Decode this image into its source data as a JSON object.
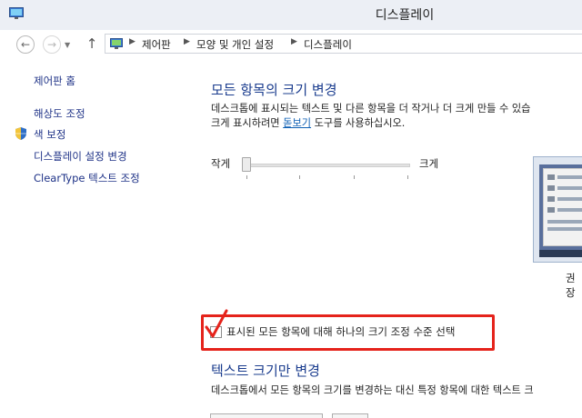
{
  "window": {
    "title": "디스플레이"
  },
  "address": {
    "crumbs": [
      "제어판",
      "모양 및 개인 설정",
      "디스플레이"
    ]
  },
  "left_nav": {
    "home": "제어판 홈",
    "items": [
      "해상도 조정",
      "색 보정",
      "디스플레이 설정 변경",
      "ClearType 텍스트 조정"
    ]
  },
  "main": {
    "heading1": "모든 항목의 크기 변경",
    "desc1_line1": "데스크톱에 표시되는 텍스트 및 다른 항목을 더 작거나 더 크게 만들 수 있습",
    "desc1_line2_pre": "크게 표시하려면 ",
    "desc1_link": "돋보기",
    "desc1_line2_post": " 도구를 사용하십시오.",
    "slider_min_label": "작게",
    "slider_max_label": "크게",
    "slider_value": 0,
    "preview_caption": "권장",
    "checkbox_label": "표시된 모든 항목에 대해 하나의 크기 조정 수준 선택",
    "checkbox_checked": false,
    "heading2": "텍스트 크기만 변경",
    "desc2": "데스크톱에서 모든 항목의 크기를 변경하는 대신 특정 항목에 대한 텍스트 크"
  },
  "icons": {
    "app": "monitor-icon",
    "back": "back-arrow-icon",
    "forward": "forward-arrow-icon",
    "recent": "chevron-down-icon",
    "up": "up-arrow-icon",
    "address": "control-panel-icon",
    "shield": "uac-shield-icon",
    "annotation": "red-checkmark-icon"
  },
  "colors": {
    "heading": "#1a3c8e",
    "link": "#1e3287",
    "highlight": "#e5231b"
  }
}
